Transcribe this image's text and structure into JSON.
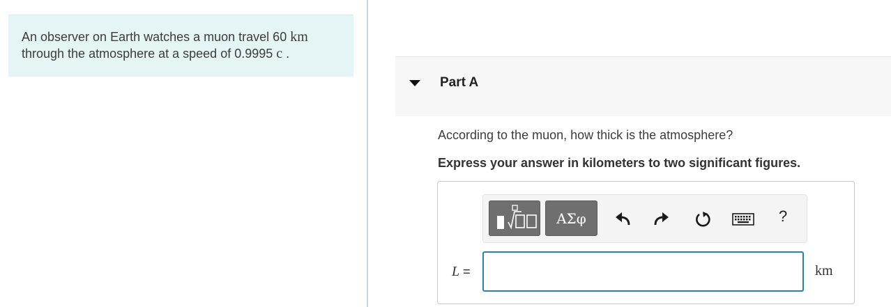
{
  "problem": {
    "text_part1": "An observer on Earth watches a muon travel 60 ",
    "unit_km": "km",
    "text_part2": "through the atmosphere at a speed of 0.9995 ",
    "symbol_c": "c",
    "text_end": " ."
  },
  "part": {
    "title": "Part A",
    "question": "According to the muon, how thick is the atmosphere?",
    "instruction": "Express your answer in kilometers to two significant figures."
  },
  "toolbar": {
    "greek_label": "ΑΣφ",
    "help_label": "?",
    "icons": [
      "templates-icon",
      "greek-symbols-icon",
      "undo-icon",
      "redo-icon",
      "reset-icon",
      "keyboard-icon",
      "help-icon"
    ]
  },
  "answer": {
    "variable": "L",
    "equals": "=",
    "value": "",
    "unit": "km"
  }
}
